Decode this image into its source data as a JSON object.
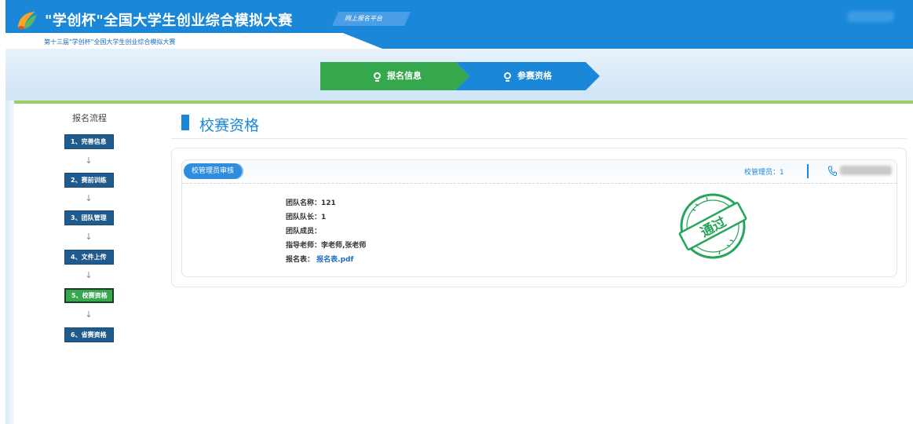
{
  "header": {
    "title": "\"学创杯\"全国大学生创业综合模拟大赛",
    "subtitle": "第十三届\"学创杯\"全国大学生创业综合模拟大赛",
    "platform_tab": "网上报名平台"
  },
  "steps": [
    {
      "label": "报名信息",
      "state": "done"
    },
    {
      "label": "参赛资格",
      "state": "current"
    }
  ],
  "sidebar": {
    "title": "报名流程",
    "items": [
      {
        "label": "1、完善信息",
        "active": false
      },
      {
        "label": "2、赛前训练",
        "active": false
      },
      {
        "label": "3、团队管理",
        "active": false
      },
      {
        "label": "4、文件上传",
        "active": false
      },
      {
        "label": "5、校赛资格",
        "active": true
      },
      {
        "label": "6、省赛资格",
        "active": false
      }
    ],
    "arrow": "↓"
  },
  "main": {
    "title": "校赛资格",
    "review_tag": "校管理员审核",
    "admin_label": "校管理员：1",
    "fields": [
      {
        "label": "团队名称：",
        "value": "121"
      },
      {
        "label": "团队队长：",
        "value": "1"
      },
      {
        "label": "团队成员：",
        "value": ""
      },
      {
        "label": "指导老师：",
        "value": "李老师,张老师"
      },
      {
        "label": "报名表：",
        "value": "报名表.pdf"
      }
    ],
    "stamp_text": "通过"
  },
  "colors": {
    "primary": "#1a87d8",
    "active_green": "#35a74d",
    "sidebar_btn": "#1f5b8c",
    "stamp_green": "#27a55a",
    "accent_line": "#9ccc65"
  }
}
